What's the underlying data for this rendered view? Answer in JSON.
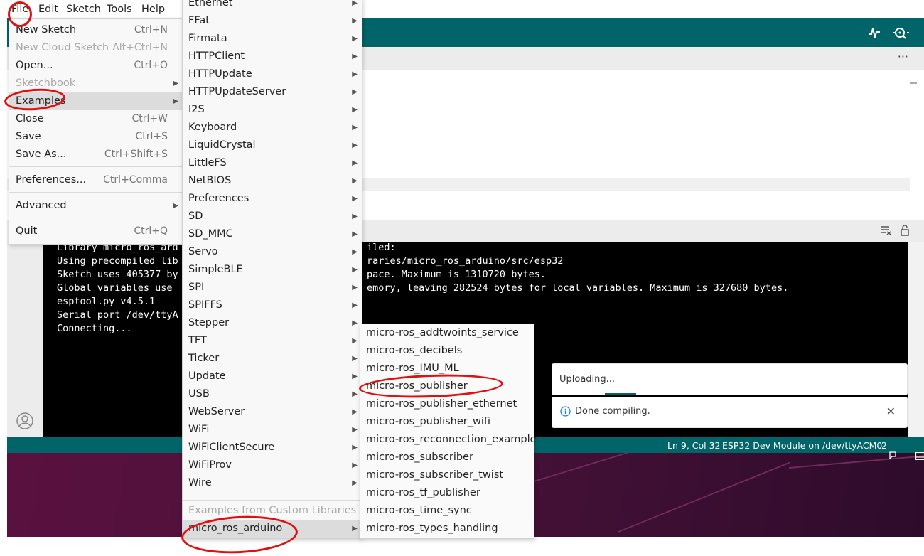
{
  "menubar": {
    "items": [
      "File",
      "Edit",
      "Sketch",
      "Tools",
      "Help"
    ]
  },
  "toolbar": {
    "serial_plotter_icon": "plotter-icon",
    "serial_monitor_icon": "monitor-icon"
  },
  "tabbar": {
    "more_label": "···"
  },
  "file_menu": {
    "items": [
      {
        "label": "New Sketch",
        "shortcut": "Ctrl+N"
      },
      {
        "label": "New Cloud Sketch",
        "shortcut": "Alt+Ctrl+N"
      },
      {
        "label": "Open...",
        "shortcut": "Ctrl+O"
      },
      {
        "label": "Sketchbook",
        "shortcut": ""
      },
      {
        "label": "Examples",
        "shortcut": ""
      },
      {
        "label": "Close",
        "shortcut": "Ctrl+W"
      },
      {
        "label": "Save",
        "shortcut": "Ctrl+S"
      },
      {
        "label": "Save As...",
        "shortcut": "Ctrl+Shift+S"
      },
      {
        "label": "Preferences...",
        "shortcut": "Ctrl+Comma"
      },
      {
        "label": "Advanced",
        "shortcut": ""
      },
      {
        "label": "Quit",
        "shortcut": "Ctrl+Q"
      }
    ]
  },
  "examples_menu": {
    "items": [
      "Ethernet",
      "FFat",
      "Firmata",
      "HTTPClient",
      "HTTPUpdate",
      "HTTPUpdateServer",
      "I2S",
      "Keyboard",
      "LiquidCrystal",
      "LittleFS",
      "NetBIOS",
      "Preferences",
      "SD",
      "SD_MMC",
      "Servo",
      "SimpleBLE",
      "SPI",
      "SPIFFS",
      "Stepper",
      "TFT",
      "Ticker",
      "Update",
      "USB",
      "WebServer",
      "WiFi",
      "WiFiClientSecure",
      "WiFiProv",
      "Wire"
    ],
    "custom_header": "Examples from Custom Libraries",
    "custom_items": [
      "micro_ros_arduino"
    ]
  },
  "microros_menu": {
    "items": [
      "micro-ros_addtwoints_service",
      "micro-ros_decibels",
      "micro-ros_IMU_ML",
      "micro-ros_publisher",
      "micro-ros_publisher_ethernet",
      "micro-ros_publisher_wifi",
      "micro-ros_reconnection_example",
      "micro-ros_subscriber",
      "micro-ros_subscriber_twist",
      "micro-ros_tf_publisher",
      "micro-ros_time_sync",
      "micro-ros_types_handling"
    ]
  },
  "console": {
    "lines": [
      {
        "left": "Library micro_ros_ard",
        "right": "iled:"
      },
      {
        "left": "Using precompiled lib",
        "right": "raries/micro_ros_arduino/src/esp32"
      },
      {
        "left": "Sketch uses 405377 by",
        "right": "pace. Maximum is 1310720 bytes."
      },
      {
        "left": "Global variables use ",
        "right": "emory, leaving 282524 bytes for local variables. Maximum is 327680 bytes."
      },
      {
        "left": "esptool.py v4.5.1",
        "right": ""
      },
      {
        "left": "Serial port /dev/ttyA",
        "right": ""
      },
      {
        "left": "Connecting...",
        "right": ""
      }
    ]
  },
  "notifications": {
    "uploading": "Uploading...",
    "done": "Done compiling."
  },
  "statusbar": {
    "cursor": "Ln 9, Col 32",
    "board": "ESP32 Dev Module on /dev/ttyACM0",
    "notification_count": "2"
  }
}
